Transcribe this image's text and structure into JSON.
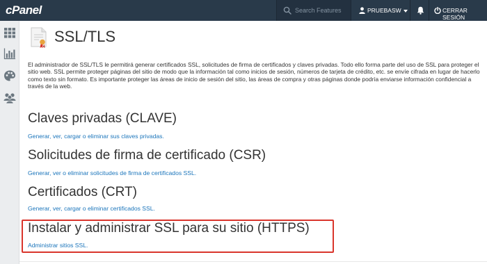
{
  "header": {
    "logo": "cPanel",
    "search": {
      "placeholder": "Search Features"
    },
    "user": {
      "name": "PRUEBASW"
    },
    "logout_label": "CERRAR SESIÓN"
  },
  "sidebar": {
    "items": [
      {
        "icon": "apps-grid-icon"
      },
      {
        "icon": "stats-chart-icon"
      },
      {
        "icon": "palette-icon"
      },
      {
        "icon": "users-icon"
      }
    ]
  },
  "page": {
    "title": "SSL/TLS",
    "intro": "El administrador de SSL/TLS le permitirá generar certificados SSL, solicitudes de firma de certificados y claves privadas. Todo ello forma parte del uso de SSL para proteger el sitio web. SSL permite proteger páginas del sitio de modo que la información tal como inicios de sesión, números de tarjeta de crédito, etc. se envíe cifrada en lugar de hacerlo como texto sin formato. Es importante proteger las áreas de inicio de sesión del sitio, las áreas de compra y otras páginas donde podría enviarse información confidencial a través de la web.",
    "sections": [
      {
        "title": "Claves privadas (CLAVE)",
        "link": "Generar, ver, cargar o eliminar sus claves privadas."
      },
      {
        "title": "Solicitudes de firma de certificado (CSR)",
        "link": "Generar, ver o eliminar solicitudes de firma de certificados SSL."
      },
      {
        "title": "Certificados (CRT)",
        "link": "Generar, ver, cargar o eliminar certificados SSL."
      },
      {
        "title": "Instalar y administrar SSL para su sitio (HTTPS)",
        "link": "Administrar sitios SSL."
      }
    ]
  },
  "colors": {
    "topbar": "#293a4a",
    "link": "#1b75bb",
    "highlight": "#d9342b"
  }
}
